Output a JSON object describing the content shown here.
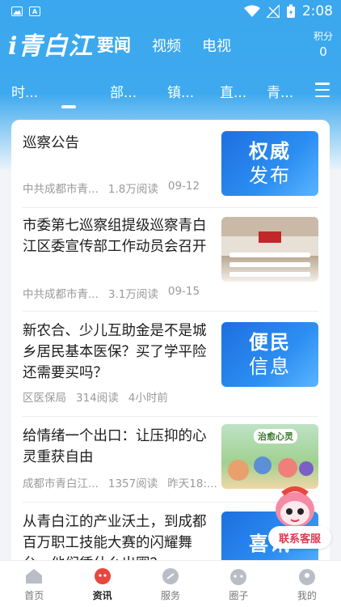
{
  "status": {
    "time": "2:08"
  },
  "brand": {
    "logo_text": "i青白江"
  },
  "top_nav": {
    "tabs": [
      "要闻",
      "视频",
      "电视"
    ]
  },
  "points": {
    "label": "积分",
    "value": "0"
  },
  "channels": [
    "时...",
    "部...",
    "镇...",
    "直...",
    "青..."
  ],
  "news": [
    {
      "title": "巡察公告",
      "source": "中共成都市青...",
      "reads": "1.8万阅读",
      "time": "09-12",
      "thumb": {
        "line1": "权威",
        "line2": "发布"
      }
    },
    {
      "title": "市委第七巡察组提级巡察青白江区委宣传部工作动员会召开",
      "source": "中共成都市青...",
      "reads": "3.1万阅读",
      "time": "09-15"
    },
    {
      "title": "新农合、少儿互助金是不是城乡居民基本医保？买了学平险还需要买吗？",
      "source": "区医保局",
      "reads": "314阅读",
      "time": "4小时前",
      "thumb": {
        "line1": "便民",
        "line2": "信息"
      }
    },
    {
      "title": "给情绪一个出口：让压抑的心灵重获自由",
      "source": "成都市青白江...",
      "reads": "1357阅读",
      "time": "昨天18:...",
      "thumb": {
        "line1": "治愈心灵"
      }
    },
    {
      "title": "从青白江的产业沃土，到成都百万职工技能大赛的闪耀舞台，他们凭什么出圈？",
      "thumb": {
        "line1": "喜讯"
      }
    }
  ],
  "customer_service": {
    "label": "联系客服"
  },
  "tabbar": [
    "首页",
    "资讯",
    "服务",
    "圈子",
    "我的"
  ],
  "colors": {
    "primary_blue": "#3aa7ee",
    "accent_red": "#e8473d"
  }
}
